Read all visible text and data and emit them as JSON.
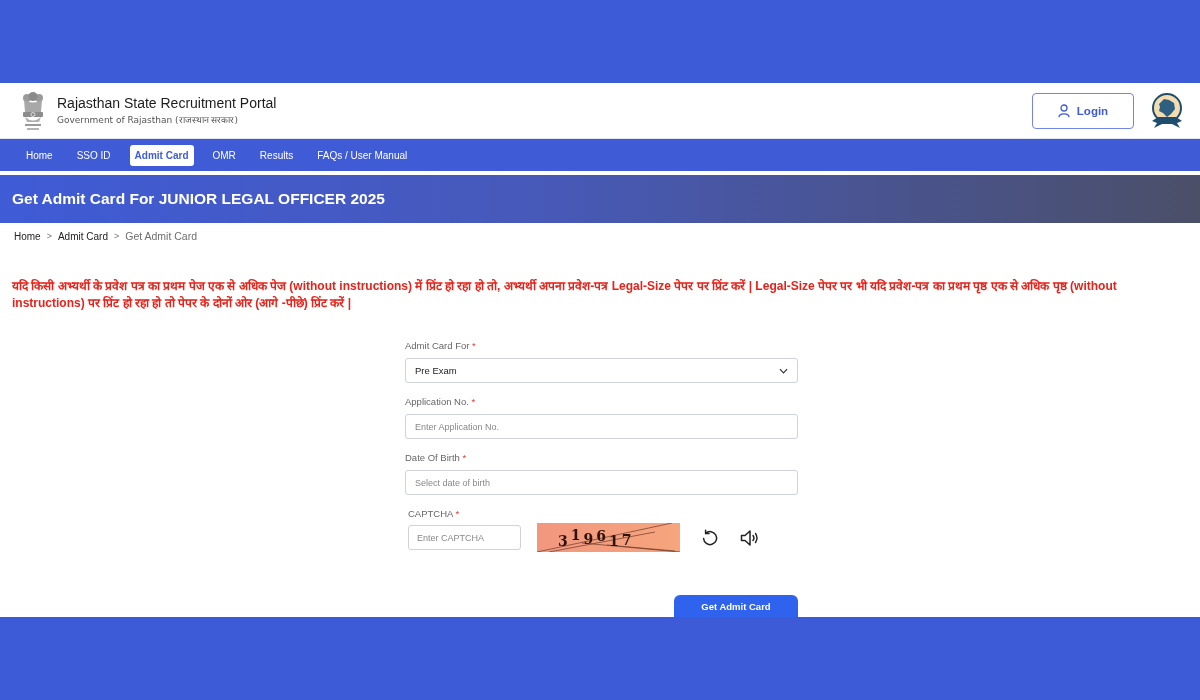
{
  "header": {
    "title": "Rajasthan State Recruitment Portal",
    "subtitle": "Government of Rajasthan (राजस्थान सरकार)",
    "login_button": "Login"
  },
  "nav": [
    {
      "label": "Home",
      "selected": false
    },
    {
      "label": "SSO ID",
      "selected": false
    },
    {
      "label": "Admit Card",
      "selected": true
    },
    {
      "label": "OMR",
      "selected": false
    },
    {
      "label": "Results",
      "selected": false
    },
    {
      "label": "FAQs / User Manual",
      "selected": false
    }
  ],
  "banner": {
    "title": "Get Admit Card For JUNIOR LEGAL OFFICER 2025"
  },
  "breadcrumb": [
    {
      "label": "Home",
      "current": false
    },
    {
      "separator": ">",
      "label": "Admit Card",
      "current": false
    },
    {
      "separator": ">",
      "label": "Get Admit Card",
      "current": true
    }
  ],
  "notice": "यदि किसी अभ्यर्थी के प्रवेश पत्र का प्रथम पेज एक से अधिक पेज (without instructions) में प्रिंट हो रहा हो तो, अभ्यर्थी अपना प्रवेश-पत्र Legal-Size पेपर पर प्रिंट करें | Legal-Size पेपर पर भी यदि प्रवेश-पत्र का प्रथम पृष्ठ एक से अधिक पृष्ठ (without instructions) पर प्रिंट हो रहा हो तो पेपर के दोनों ओर (आगे -पीछे) प्रिंट करें |",
  "form": {
    "fields": [
      {
        "kind": "select",
        "label": "Admit Card For",
        "required_mark": "*",
        "value": "Pre Exam"
      },
      {
        "kind": "text",
        "label": "Application No.",
        "required_mark": "*",
        "placeholder": "Enter Application No."
      },
      {
        "kind": "date",
        "label": "Date Of Birth",
        "required_mark": "*",
        "placeholder": "Select date of birth"
      }
    ],
    "captcha": {
      "label": "CAPTCHA",
      "required_mark": "*",
      "placeholder": "Enter CAPTCHA",
      "code": "319617"
    },
    "submit_button": "Get Admit Card"
  }
}
